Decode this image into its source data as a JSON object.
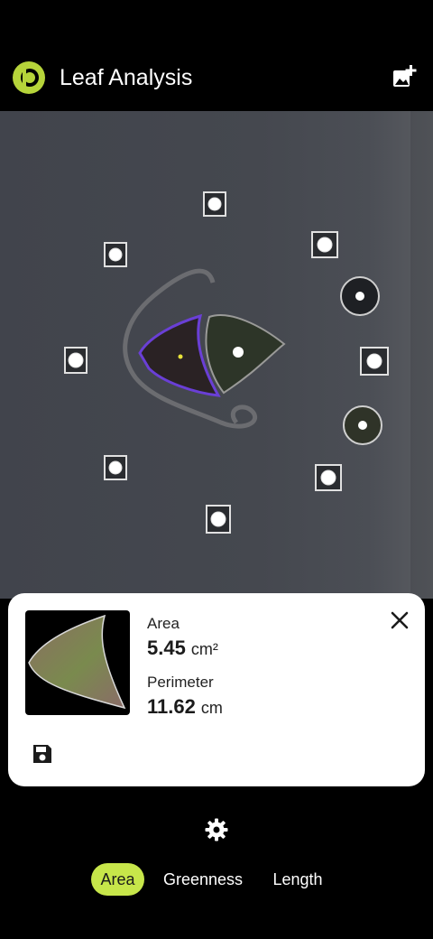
{
  "app": {
    "title": "Leaf Analysis"
  },
  "icons": {
    "logo": "leaf-logo-icon",
    "add_photo": "add-photo-icon",
    "close": "close-icon",
    "save": "save-icon",
    "settings": "gear-icon"
  },
  "results": {
    "area_label": "Area",
    "area_value": "5.45",
    "area_unit": "cm²",
    "perimeter_label": "Perimeter",
    "perimeter_value": "11.62",
    "perimeter_unit": "cm"
  },
  "tabs": [
    {
      "label": "Area",
      "active": true
    },
    {
      "label": "Greenness",
      "active": false
    },
    {
      "label": "Length",
      "active": false
    }
  ],
  "colors": {
    "accent": "#c7e64a",
    "selection_outline": "#6a3fd6",
    "background": "#000000"
  }
}
